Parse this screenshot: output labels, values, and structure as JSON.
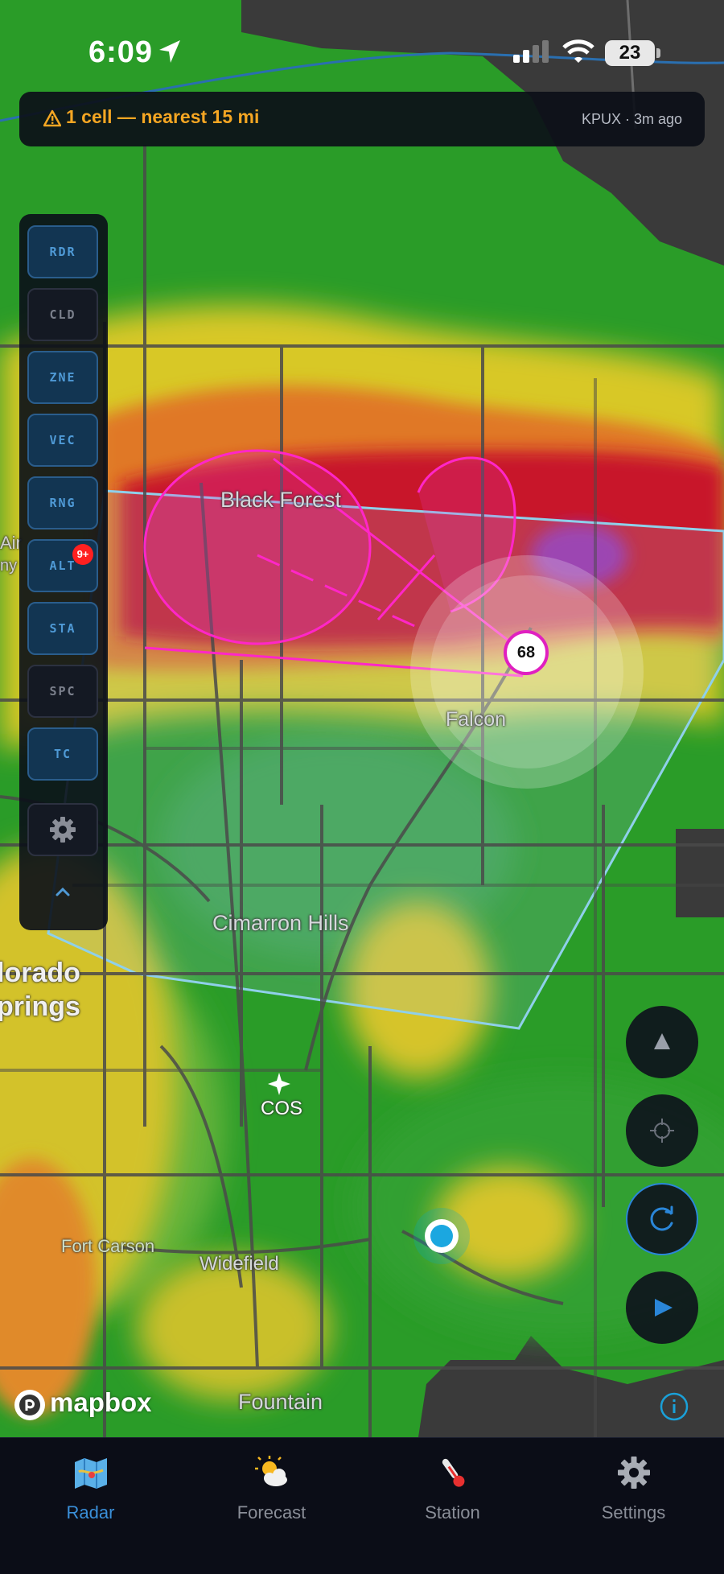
{
  "status_bar": {
    "time": "6:09",
    "battery": "23"
  },
  "alert": {
    "message": "1 cell — nearest 15 mi",
    "source": "KPUX · 3m ago"
  },
  "toolbar": {
    "buttons": [
      {
        "label": "RDR",
        "active": true
      },
      {
        "label": "CLD",
        "active": false
      },
      {
        "label": "ZNE",
        "active": true
      },
      {
        "label": "VEC",
        "active": true
      },
      {
        "label": "RNG",
        "active": true
      },
      {
        "label": "ALT",
        "active": true,
        "badge": "9+"
      },
      {
        "label": "STA",
        "active": true
      },
      {
        "label": "SPC",
        "active": false
      },
      {
        "label": "TC",
        "active": true
      }
    ]
  },
  "map": {
    "places": {
      "black_forest": "Black Forest",
      "falcon": "Falcon",
      "cimarron_hills": "Cimarron Hills",
      "colorado_springs_1": "lorado",
      "colorado_springs_2": "prings",
      "airport": "COS",
      "fort_carson": "Fort Carson",
      "widefield": "Widefield",
      "fountain": "Fountain",
      "edge_1": "Air",
      "edge_2": "ny"
    },
    "cell_marker": "68",
    "attribution": "mapbox"
  },
  "tabs": [
    {
      "label": "Radar",
      "icon": "map-icon",
      "active": true
    },
    {
      "label": "Forecast",
      "icon": "sun-cloud-icon",
      "active": false
    },
    {
      "label": "Station",
      "icon": "thermometer-icon",
      "active": false
    },
    {
      "label": "Settings",
      "icon": "gear-icon",
      "active": false
    }
  ],
  "colors": {
    "accent": "#3a8fd8",
    "warning": "#f5a623",
    "cell_pink": "#e020c0",
    "warning_box": "#8fd0ea"
  }
}
